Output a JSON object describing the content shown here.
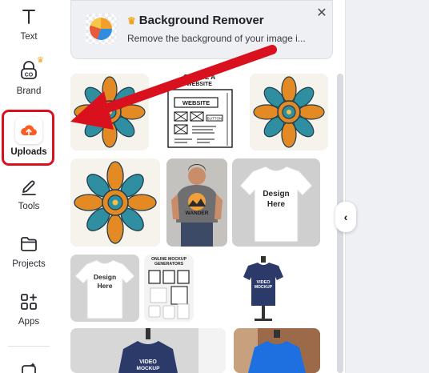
{
  "sidebar": {
    "items": [
      {
        "label": "Text",
        "icon": "text-icon"
      },
      {
        "label": "Brand",
        "icon": "brand-icon"
      },
      {
        "label": "Uploads",
        "icon": "upload-cloud-icon",
        "active": true
      },
      {
        "label": "Tools",
        "icon": "tools-icon"
      },
      {
        "label": "Projects",
        "icon": "folder-icon"
      },
      {
        "label": "Apps",
        "icon": "apps-icon"
      }
    ]
  },
  "promo": {
    "title": "Background Remover",
    "description": "Remove the background of your image i..."
  },
  "uploads": {
    "website_sketch": {
      "header": "CREATE A",
      "header2": "WEBSITE",
      "box_label": "WEBSITE",
      "button_label": "BUTTON"
    },
    "tshirt_design_text": "Design Here",
    "man_shirt_text": "WANDER",
    "mockup_generators": "ONLINE MOCKUP GENERATORS",
    "video_mockup": "VIDEO MOCKUP"
  },
  "colors": {
    "accent_red": "#d9101e",
    "upload_orange": "#ff5a1f",
    "crown_gold": "#f2a31b"
  }
}
